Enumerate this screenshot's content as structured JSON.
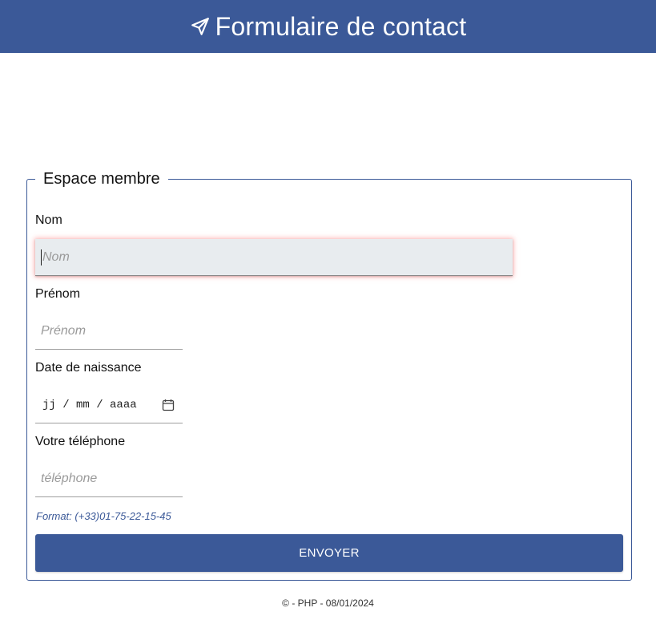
{
  "header": {
    "title": "Formulaire de contact",
    "icon": "send-icon"
  },
  "form": {
    "legend": "Espace membre",
    "nom": {
      "label": "Nom",
      "placeholder": "Nom"
    },
    "prenom": {
      "label": "Prénom",
      "placeholder": "Prénom"
    },
    "naissance": {
      "label": "Date de naissance",
      "placeholder": "jj / mm / aaaa",
      "icon": "calendar-icon"
    },
    "telephone": {
      "label": "Votre téléphone",
      "placeholder": "téléphone",
      "hint": "Format: (+33)01-75-22-15-45"
    },
    "submit_label": "ENVOYER"
  },
  "footer": {
    "text": "© - PHP - 08/01/2024"
  },
  "colors": {
    "brand": "#3b5998",
    "focus_bg": "#e8ecef",
    "focus_glow": "#ff7878"
  }
}
